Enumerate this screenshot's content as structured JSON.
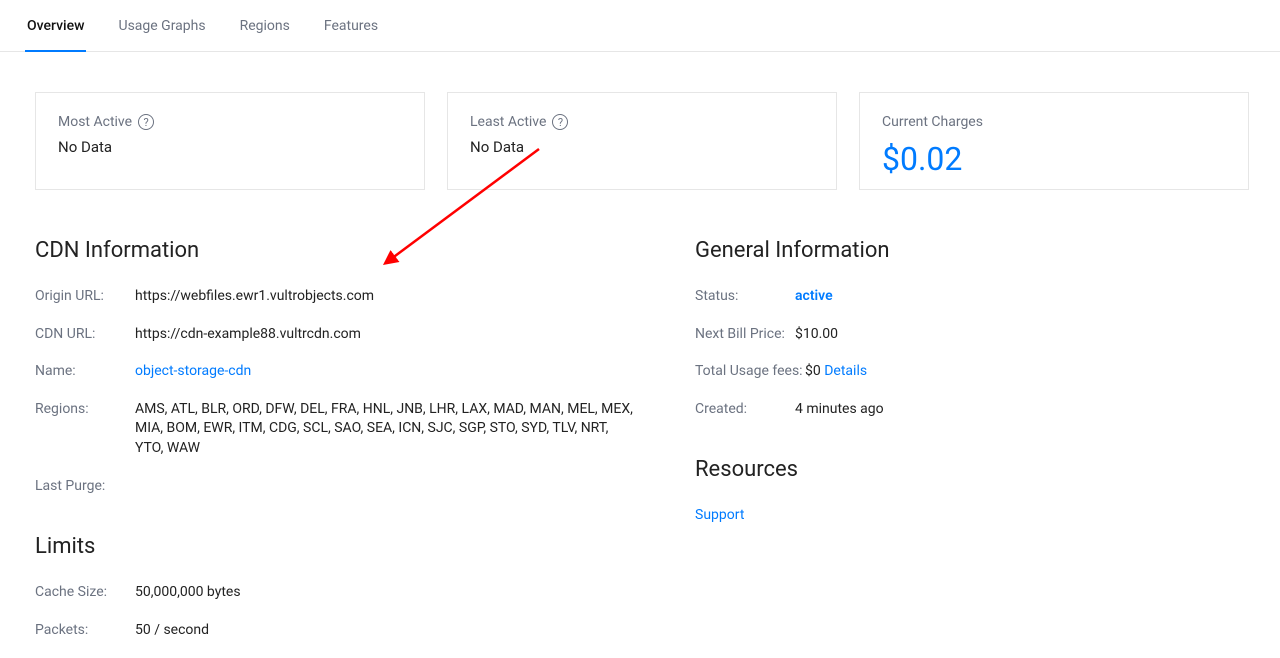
{
  "tabs": [
    {
      "label": "Overview",
      "active": true
    },
    {
      "label": "Usage Graphs",
      "active": false
    },
    {
      "label": "Regions",
      "active": false
    },
    {
      "label": "Features",
      "active": false
    }
  ],
  "cards": {
    "most_active": {
      "label": "Most Active",
      "value": "No Data"
    },
    "least_active": {
      "label": "Least Active",
      "value": "No Data"
    },
    "current_charges": {
      "label": "Current Charges",
      "value": "$0.02"
    }
  },
  "cdn_info": {
    "heading": "CDN Information",
    "origin_url": {
      "key": "Origin URL:",
      "val": "https://webfiles.ewr1.vultrobjects.com"
    },
    "cdn_url": {
      "key": "CDN URL:",
      "val": "https://cdn-example88.vultrcdn.com"
    },
    "name": {
      "key": "Name:",
      "val": "object-storage-cdn"
    },
    "regions": {
      "key": "Regions:",
      "val": "AMS, ATL, BLR, ORD, DFW, DEL, FRA, HNL, JNB, LHR, LAX, MAD, MAN, MEL, MEX, MIA, BOM, EWR, ITM, CDG, SCL, SAO, SEA, ICN, SJC, SGP, STO, SYD, TLV, NRT, YTO, WAW"
    },
    "last_purge": {
      "key": "Last Purge:",
      "val": ""
    }
  },
  "limits": {
    "heading": "Limits",
    "cache_size": {
      "key": "Cache Size:",
      "val": "50,000,000 bytes"
    },
    "packets": {
      "key": "Packets:",
      "val": "50 / second"
    }
  },
  "general_info": {
    "heading": "General Information",
    "status": {
      "key": "Status:",
      "val": "active"
    },
    "next_bill": {
      "key": "Next Bill Price:",
      "val": "$10.00"
    },
    "usage_fees": {
      "key": "Total Usage fees:",
      "val": "$0",
      "details": "Details"
    },
    "created": {
      "key": "Created:",
      "val": "4 minutes ago"
    }
  },
  "resources": {
    "heading": "Resources",
    "support": "Support"
  }
}
